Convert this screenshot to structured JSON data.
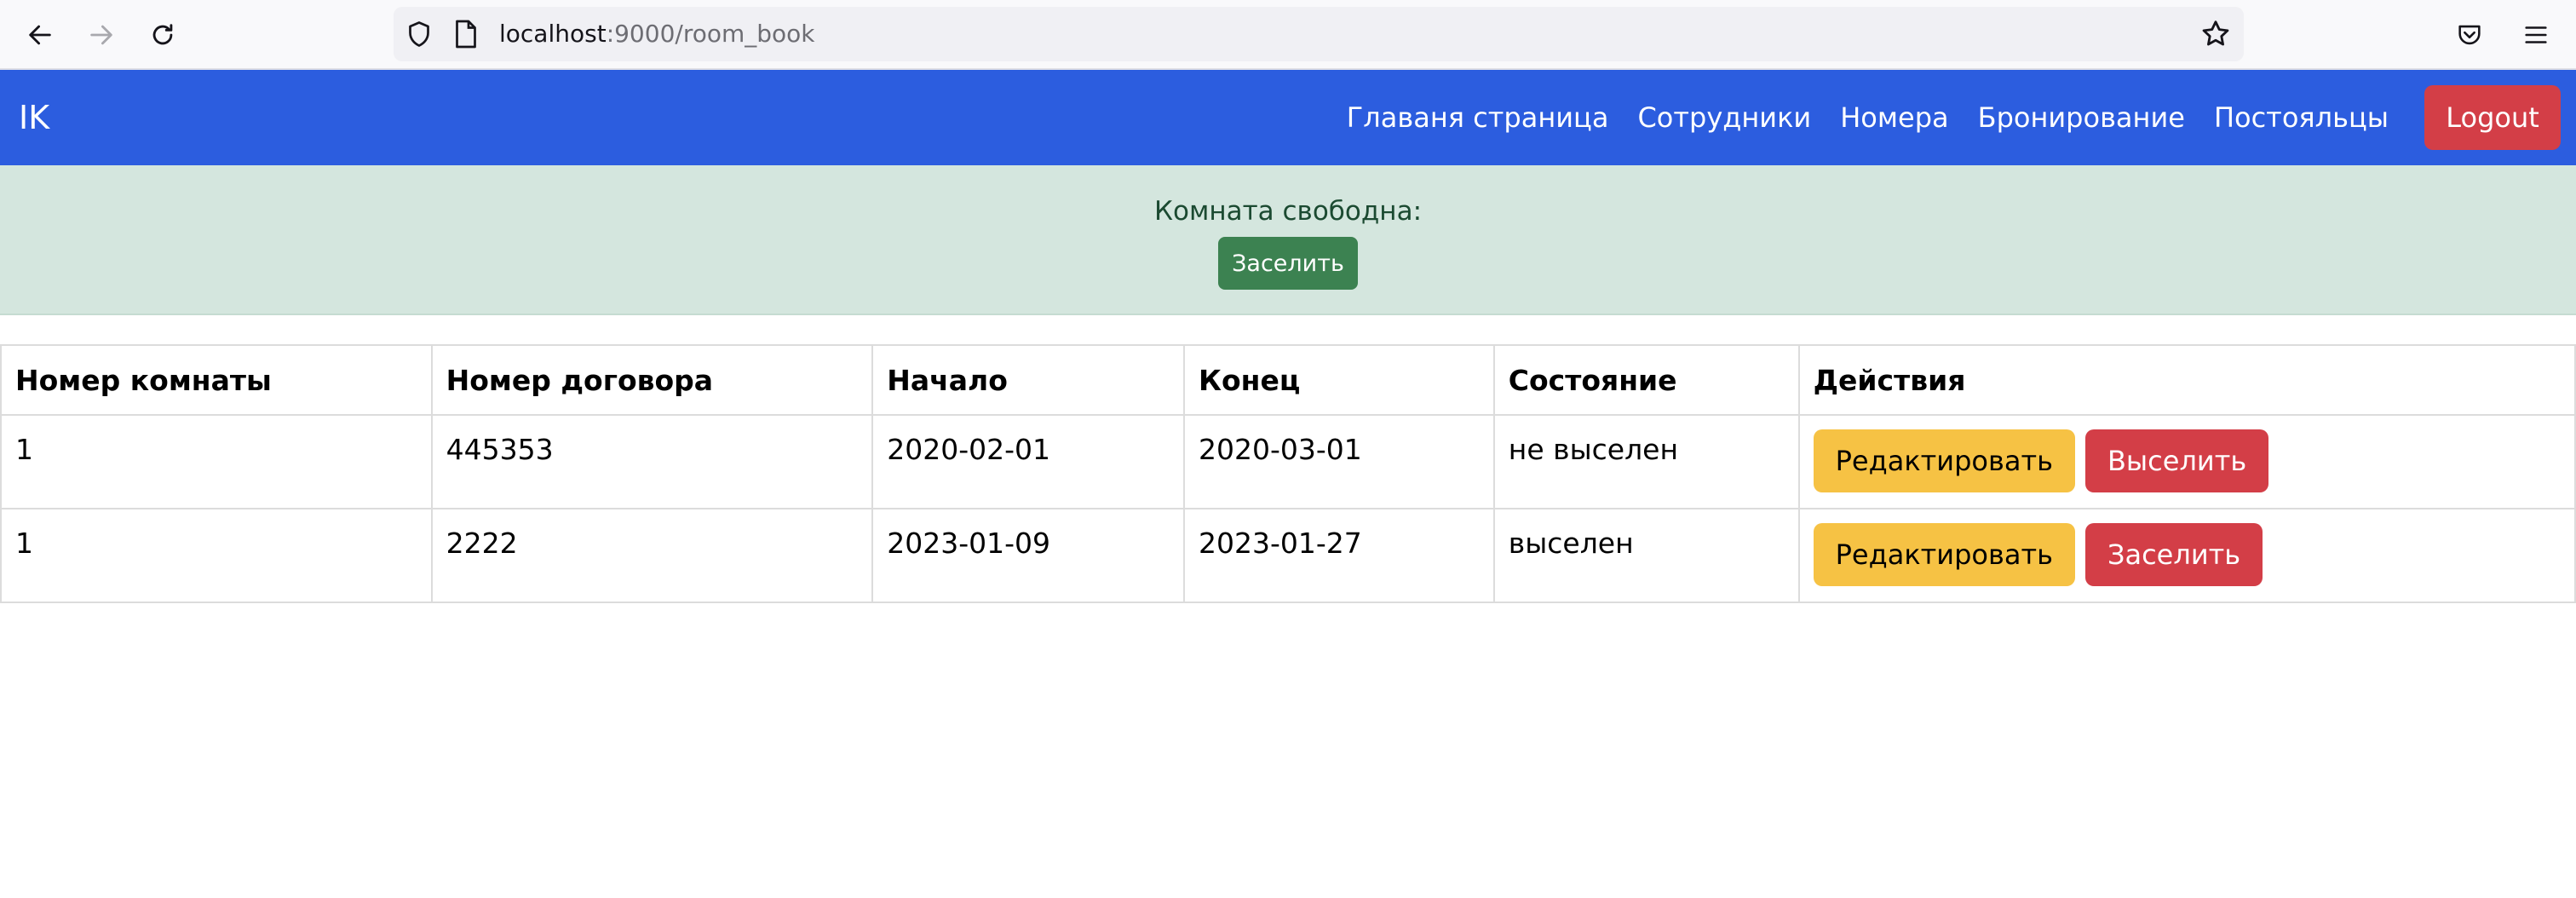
{
  "browser": {
    "url_host": "localhost",
    "url_rest": ":9000/room_book"
  },
  "navbar": {
    "brand": "IK",
    "links": [
      "Главаня страница",
      "Сотрудники",
      "Номера",
      "Бронирование",
      "Постояльцы"
    ],
    "logout_label": "Logout",
    "bg_color": "#2c5ddf"
  },
  "alert": {
    "text": "Комната свободна:",
    "button_label": "Заселить"
  },
  "table": {
    "headers": [
      "Номер комнаты",
      "Номер договора",
      "Начало",
      "Конец",
      "Состояние",
      "Действия"
    ],
    "rows": [
      {
        "room": "1",
        "contract": "445353",
        "start": "2020-02-01",
        "end": "2020-03-01",
        "state": "не выселен",
        "edit_label": "Редактировать",
        "action_label": "Выселить"
      },
      {
        "room": "1",
        "contract": "2222",
        "start": "2023-01-09",
        "end": "2023-01-27",
        "state": "выселен",
        "edit_label": "Редактировать",
        "action_label": "Заселить"
      }
    ]
  }
}
